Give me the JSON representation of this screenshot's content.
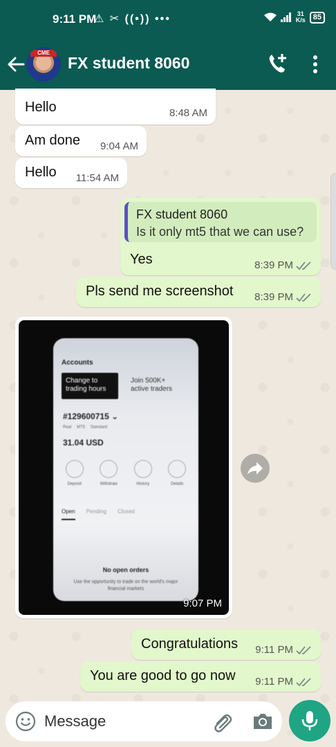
{
  "statusbar": {
    "time": "9:11 PM",
    "icons": "⚠ ✂ ((•)) •••",
    "speed_value": "31",
    "speed_unit": "K/s",
    "battery": "85"
  },
  "header": {
    "contact_name": "FX student 8060",
    "avatar_logo_text": "CME"
  },
  "messages": {
    "m1": {
      "text": "Hello",
      "time": "8:48 AM"
    },
    "m2": {
      "text": "Am done",
      "time": "9:04 AM"
    },
    "m3": {
      "text": "Hello",
      "time": "11:54 AM"
    },
    "m4": {
      "quoted_name": "FX student 8060",
      "quoted_text": "Is it only mt5 that we can use?",
      "text": "Yes",
      "time": "8:39 PM"
    },
    "m5": {
      "text": "Pls send me screenshot",
      "time": "8:39 PM"
    },
    "photo": {
      "time": "9:07 PM",
      "screen": {
        "accounts": "Accounts",
        "card1": "Change to trading hours",
        "card2": "Join 500K+ active traders",
        "account_no": "#129600715 ⌄",
        "account_sub": "Real MT5 Standard",
        "balance": "31.04 USD",
        "btn_deposit": "Deposit",
        "btn_withdraw": "Withdraw",
        "btn_history": "History",
        "btn_details": "Details",
        "tab_open": "Open",
        "tab_pending": "Pending",
        "tab_closed": "Closed",
        "empty_title": "No open orders",
        "empty_text": "Use the opportunity to trade on the world's major financial markets"
      }
    },
    "m6": {
      "text": "Congratulations",
      "time": "9:11 PM"
    },
    "m7": {
      "text": "You are good to go now",
      "time": "9:11 PM"
    }
  },
  "composer": {
    "placeholder": "Message"
  },
  "colors": {
    "header": "#0b5b52",
    "outgoing_bubble": "#e2f7cb",
    "incoming_bubble": "#ffffff",
    "mic_button": "#1fa484",
    "quote_bar": "#5e4fc9"
  }
}
